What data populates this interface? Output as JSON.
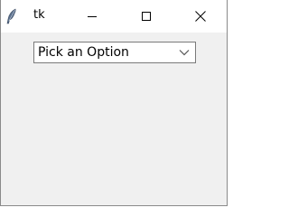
{
  "window": {
    "title": "tk"
  },
  "titlebar": {
    "app_icon": "feather-icon",
    "minimize_icon": "minimize-icon",
    "maximize_icon": "maximize-icon",
    "close_icon": "close-icon"
  },
  "combobox": {
    "selected_value": "Pick an Option",
    "arrow_icon": "chevron-down-icon"
  },
  "colors": {
    "window_bg": "#f0f0f0",
    "titlebar_bg": "#ffffff",
    "field_border": "#7a7a7a"
  }
}
